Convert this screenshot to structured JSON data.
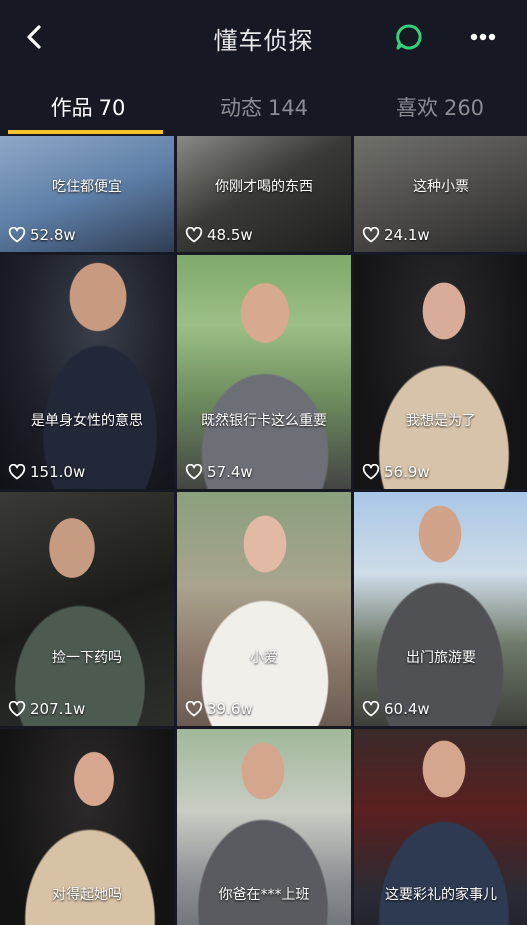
{
  "header": {
    "title": "懂车侦探",
    "back_icon": "chevron-left-icon",
    "chat_icon": "chat-bubble-icon",
    "more_icon": "more-dots-icon",
    "accent": "#33d17a"
  },
  "tabs": [
    {
      "label": "作品",
      "count": "70",
      "active": true
    },
    {
      "label": "动态",
      "count": "144",
      "active": false
    },
    {
      "label": "喜欢",
      "count": "260",
      "active": false
    }
  ],
  "indicator_color": "#f6c42a",
  "videos": [
    {
      "caption": "吃住都便宜",
      "likes": "52.8w"
    },
    {
      "caption": "你刚才喝的东西",
      "likes": "48.5w"
    },
    {
      "caption": "这种小票",
      "likes": "24.1w"
    },
    {
      "caption": "是单身女性的意思",
      "likes": "151.0w"
    },
    {
      "caption": "既然银行卡这么重要",
      "likes": "57.4w"
    },
    {
      "caption": "我想是为了",
      "likes": "56.9w"
    },
    {
      "caption": "捡一下药吗",
      "likes": "207.1w"
    },
    {
      "caption": "小爱",
      "likes": "39.6w"
    },
    {
      "caption": "出门旅游要",
      "likes": "60.4w"
    },
    {
      "caption": "对得起她吗",
      "likes": ""
    },
    {
      "caption": "你爸在***上班",
      "likes": ""
    },
    {
      "caption": "这要彩礼的家事儿",
      "likes": ""
    }
  ]
}
